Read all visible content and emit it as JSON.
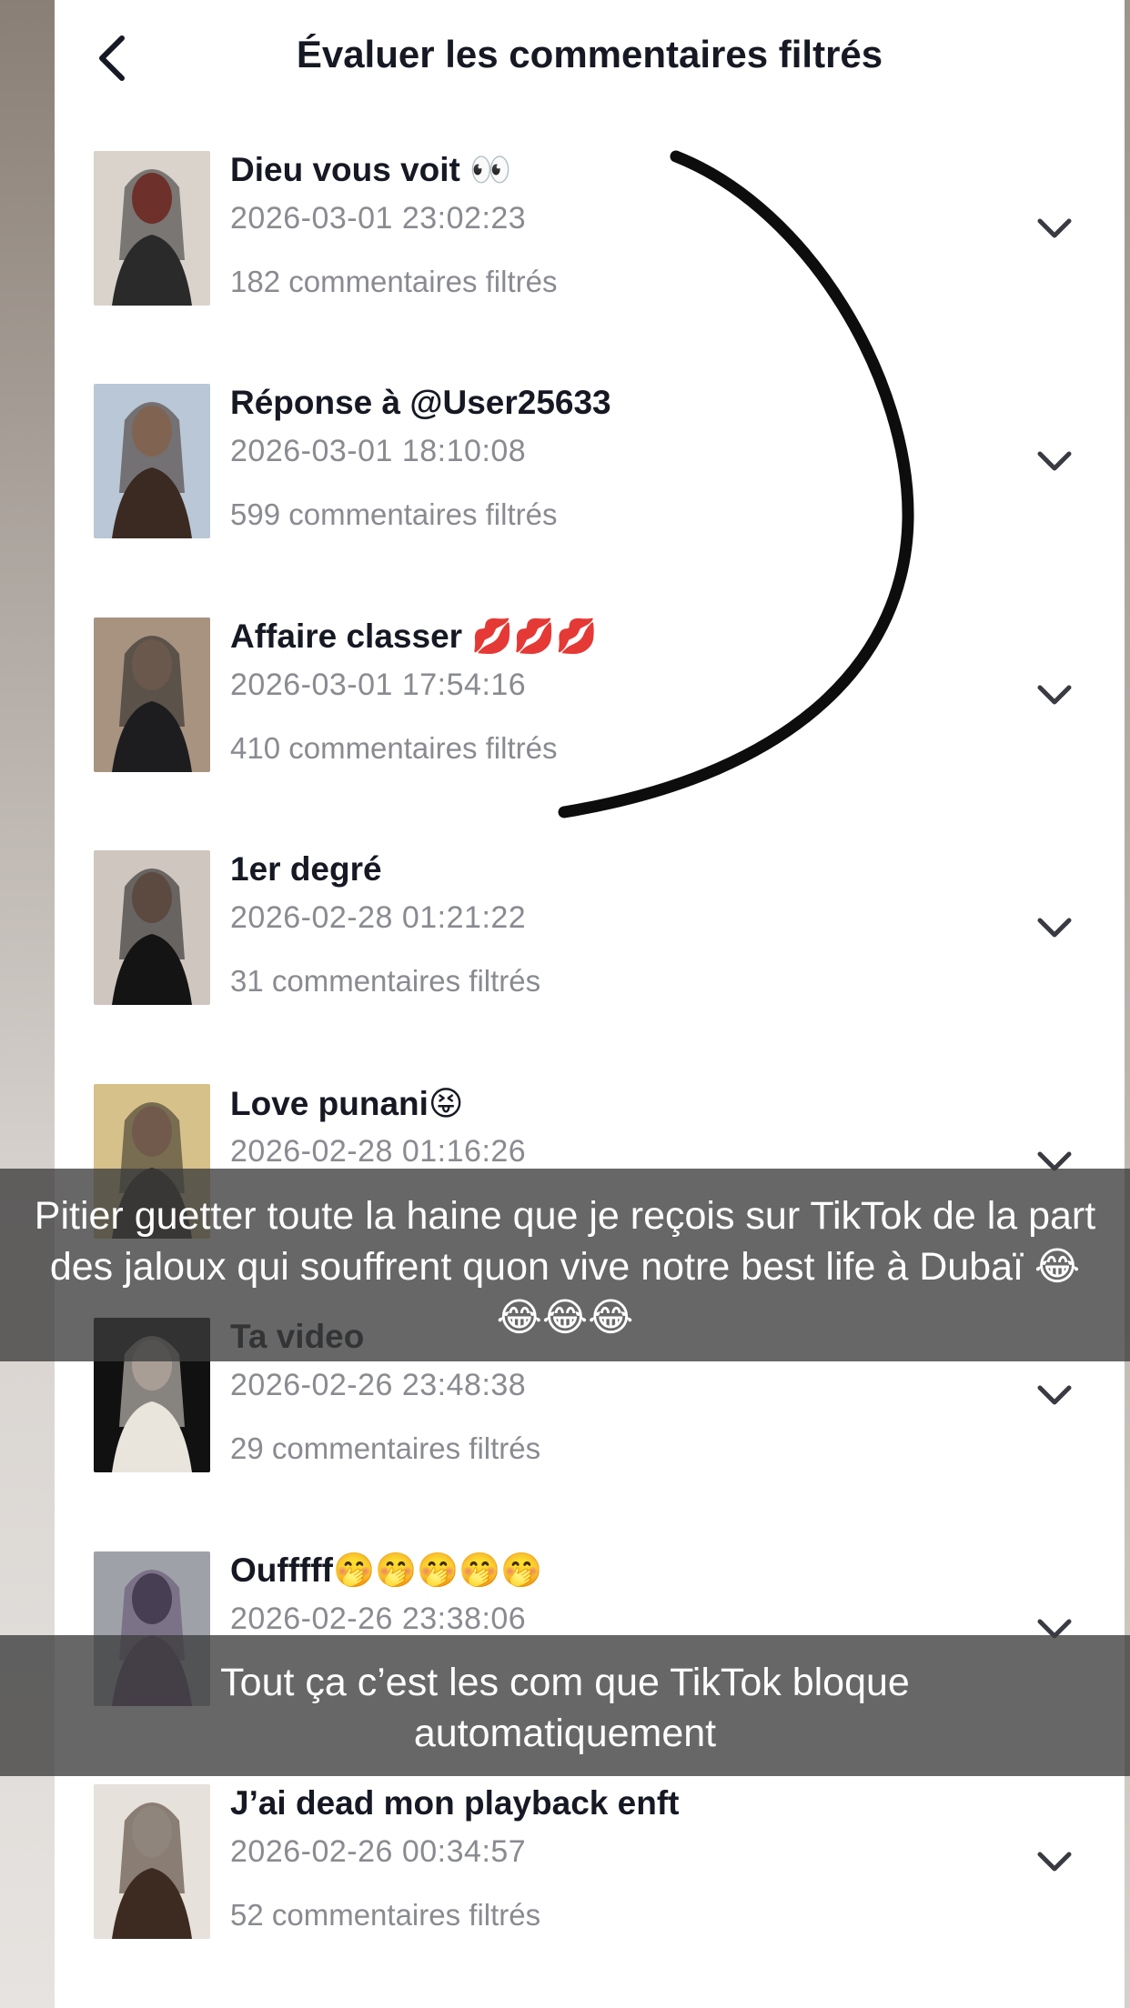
{
  "header": {
    "title": "Évaluer les commentaires filtrés"
  },
  "items": [
    {
      "title": "Dieu vous voit 👀",
      "date": "2026-03-01 23:02:23",
      "count": "182 commentaires filtrés",
      "thumb_colors": [
        "#d9d3cc",
        "#2a2a2a",
        "#c0392b"
      ]
    },
    {
      "title": "Réponse à @User25633",
      "date": "2026-03-01 18:10:08",
      "count": "599 commentaires filtrés",
      "thumb_colors": [
        "#b9c7d6",
        "#3b2a22",
        "#d7a98b"
      ]
    },
    {
      "title": "Affaire classer 💋💋💋",
      "date": "2026-03-01 17:54:16",
      "count": "410 commentaires filtrés",
      "thumb_colors": [
        "#a7937f",
        "#1d1d1f",
        "#c9a184"
      ]
    },
    {
      "title": "1er degré",
      "date": "2026-02-28 01:21:22",
      "count": "31 commentaires filtrés",
      "thumb_colors": [
        "#cfc6c0",
        "#141414",
        "#b48d78"
      ]
    },
    {
      "title": "Love punani😝",
      "date": "2026-02-28 01:16:26",
      "count": "",
      "thumb_colors": [
        "#d6c18a",
        "#2c2623",
        "#c59a7e"
      ]
    },
    {
      "title": "Ta video",
      "date": "2026-02-26 23:48:38",
      "count": "29 commentaires filtrés",
      "thumb_colors": [
        "#111111",
        "#e9e4dc",
        "#5a4a3f"
      ]
    },
    {
      "title": "Oufffff🤭🤭🤭🤭🤭",
      "date": "2026-02-26 23:38:06",
      "count": "",
      "thumb_colors": [
        "#9ea2a8",
        "#5f4b6e",
        "#2b2f36"
      ]
    },
    {
      "title": "J’ai dead mon playback enft",
      "date": "2026-02-26 00:34:57",
      "count": "52 commentaires filtrés",
      "thumb_colors": [
        "#e6e1da",
        "#3d2b21",
        "#f3f1ee"
      ]
    }
  ],
  "captions": {
    "first": "Pitier guetter toute la haine que je reçois sur TikTok de la part des jaloux qui souffrent quon vive notre best life à Dubaï 😂😂😂😂",
    "second": "Tout ça c’est les com que TikTok bloque automatiquement"
  }
}
